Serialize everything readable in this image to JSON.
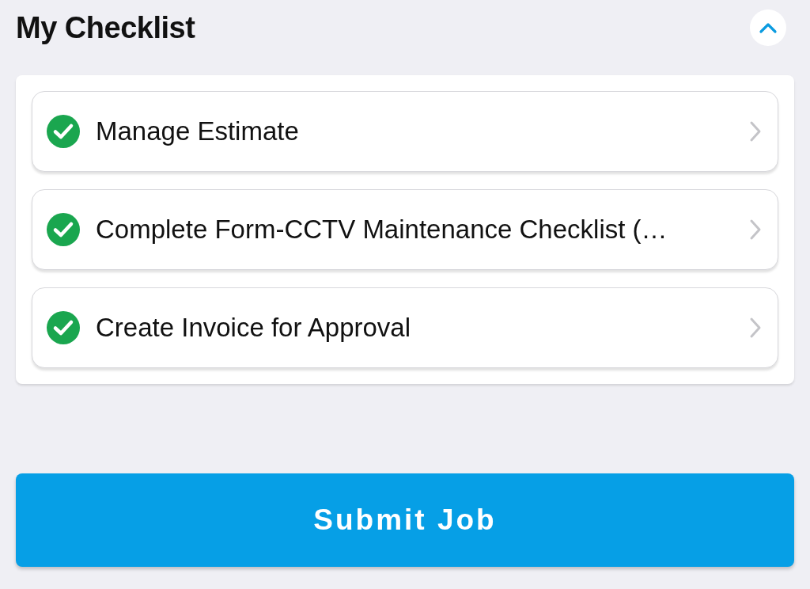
{
  "header": {
    "title": "My Checklist",
    "expanded": true
  },
  "checklist": [
    {
      "label": "Manage Estimate",
      "completed": true
    },
    {
      "label": "Complete Form-CCTV Maintenance Checklist (…",
      "completed": true
    },
    {
      "label": "Create Invoice for Approval",
      "completed": true
    }
  ],
  "submit_button": {
    "label": "Submit Job"
  }
}
